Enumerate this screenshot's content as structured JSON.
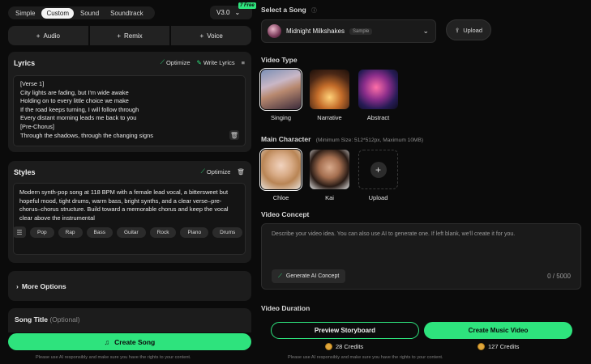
{
  "mode_tabs": [
    "Simple",
    "Custom",
    "Sound",
    "Soundtrack"
  ],
  "version": {
    "label": "V3.0",
    "badge": "7 Free"
  },
  "add_buttons": [
    "Audio",
    "Remix",
    "Voice"
  ],
  "lyrics": {
    "title": "Lyrics",
    "optimize": "Optimize",
    "write": "Write Lyrics",
    "lines": [
      "[Verse 1]",
      "City lights are fading, but I'm wide awake",
      "Holding on to every little choice we make",
      "If the road keeps turning, I will follow through",
      "Every distant morning leads me back to you",
      "[Pre-Chorus]",
      "Through the shadows, through the changing signs"
    ]
  },
  "styles": {
    "title": "Styles",
    "optimize": "Optimize",
    "text": "Modern synth-pop song at 118 BPM with a female lead vocal, a bittersweet but hopeful mood, tight drums, warm bass, bright synths, and a clear verse–pre-chorus–chorus structure. Build toward a memorable chorus and keep the vocal clear above the instrumental",
    "tags": [
      "Pop",
      "Rap",
      "Bass",
      "Guitar",
      "Rock",
      "Piano",
      "Drums"
    ]
  },
  "more_options": "More Options",
  "song_title": {
    "label": "Song Title",
    "optional": "(Optional)"
  },
  "create_song": "Create Song",
  "disclaimer": "Please use AI responsibly and make sure you have the rights to your content.",
  "select_song": {
    "label": "Select a Song",
    "song": "Midnight Milkshakes",
    "sample": "Sample",
    "upload": "Upload"
  },
  "video_type": {
    "label": "Video Type",
    "options": [
      "Singing",
      "Narrative",
      "Abstract"
    ],
    "selected": "Singing"
  },
  "main_character": {
    "label": "Main Character",
    "hint": "(Minimum Size: 512*512px, Maximum 10MB)",
    "options": [
      "Chloe",
      "Kai",
      "Upload"
    ],
    "selected": "Chloe"
  },
  "video_concept": {
    "label": "Video Concept",
    "placeholder": "Describe your video idea. You can also use AI to generate one. If left blank, we'll create it for you.",
    "generate": "Generate AI Concept",
    "counter": "0 / 5000"
  },
  "video_duration": {
    "label": "Video Duration"
  },
  "preview": {
    "label": "Preview Storyboard",
    "credits": "28 Credits"
  },
  "create_video": {
    "label": "Create Music Video",
    "credits": "127 Credits"
  },
  "colors": {
    "accent": "#2ee37d",
    "bg": "#0b0b0b",
    "panel": "#1c1c1c"
  }
}
